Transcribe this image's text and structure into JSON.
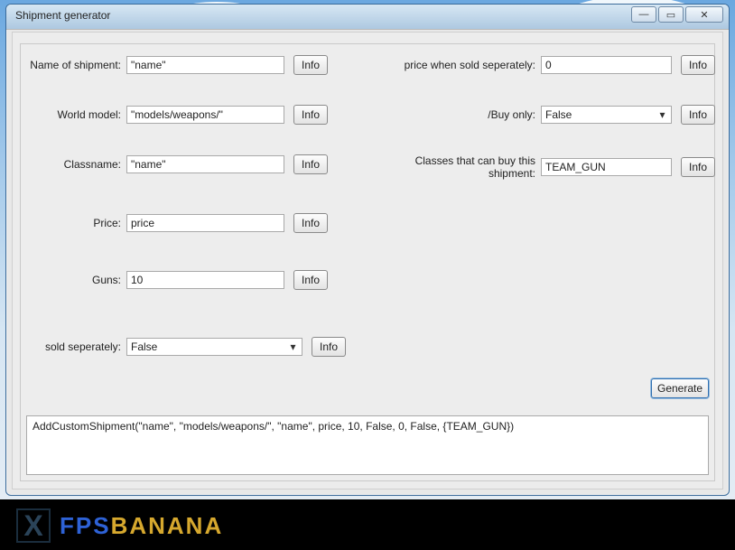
{
  "window": {
    "title": "Shipment generator"
  },
  "fields": {
    "name": {
      "label": "Name of shipment:",
      "value": "\"name\""
    },
    "model": {
      "label": "World model:",
      "value": "\"models/weapons/\""
    },
    "classname": {
      "label": "Classname:",
      "value": "\"name\""
    },
    "price": {
      "label": "Price:",
      "value": "price"
    },
    "guns": {
      "label": "Guns:",
      "value": "10"
    },
    "soldsep": {
      "label": "sold seperately:",
      "value": "False"
    },
    "pricesep": {
      "label": "price when sold seperately:",
      "value": "0"
    },
    "buyonly": {
      "label": "/Buy only:",
      "value": "False"
    },
    "classes": {
      "label": "Classes that can buy this shipment:",
      "value": "TEAM_GUN"
    }
  },
  "buttons": {
    "info": "Info",
    "generate": "Generate"
  },
  "output": "AddCustomShipment(\"name\", \"models/weapons/\", \"name\", price, 10, False, 0, False, {TEAM_GUN})",
  "footer": {
    "logo1": "FPS",
    "logo2": "BANANA"
  }
}
